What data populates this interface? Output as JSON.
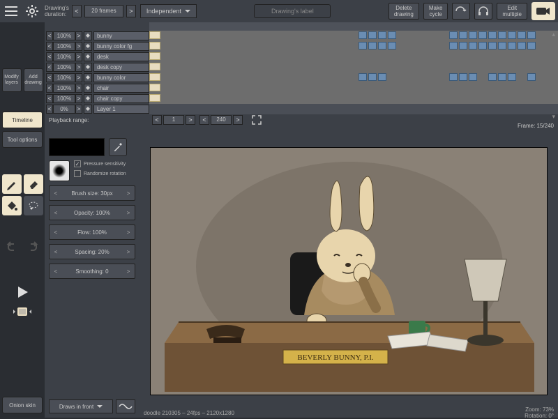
{
  "top": {
    "duration_label_1": "Drawing's",
    "duration_label_2": "duration:",
    "duration_value": "20 frames",
    "cel_mode": "Independent",
    "drawings_label_placeholder": "Drawing's label",
    "delete_1": "Delete",
    "delete_2": "drawing",
    "cycle_1": "Make",
    "cycle_2": "cycle",
    "edit_1": "Edit",
    "edit_2": "multiple"
  },
  "rail": {
    "modify": "Modify\nlayers",
    "add": "Add\ndrawing",
    "timeline": "Timeline",
    "toolopts": "Tool options",
    "onion": "Onion skin"
  },
  "layers": [
    {
      "opacity": "100%",
      "name": "bunny"
    },
    {
      "opacity": "100%",
      "name": "bunny color fg"
    },
    {
      "opacity": "100%",
      "name": "desk"
    },
    {
      "opacity": "100%",
      "name": "desk copy"
    },
    {
      "opacity": "100%",
      "name": "bunny color"
    },
    {
      "opacity": "100%",
      "name": "chair"
    },
    {
      "opacity": "100%",
      "name": "chair copy"
    },
    {
      "opacity": "0%",
      "name": "Layer 1"
    }
  ],
  "playback": {
    "label": "Playback range:",
    "from": "1",
    "to": "240"
  },
  "frame_info": "Frame: 15/240",
  "tool": {
    "pressure": "Pressure sensitivity",
    "randomize": "Randomize rotation",
    "brush": "Brush size: 30px",
    "opacity": "Opacity: 100%",
    "flow": "Flow: 100%",
    "spacing": "Spacing: 20%",
    "smoothing": "Smoothing: 0",
    "draws": "Draws in front"
  },
  "canvas_nameplate": "BEVERLY BUNNY, P.I.",
  "footer": {
    "file": "doodle 210305 – 24fps – 2120x1280",
    "zoom": "Zoom: 73%",
    "rotation": "Rotation: 0°"
  }
}
